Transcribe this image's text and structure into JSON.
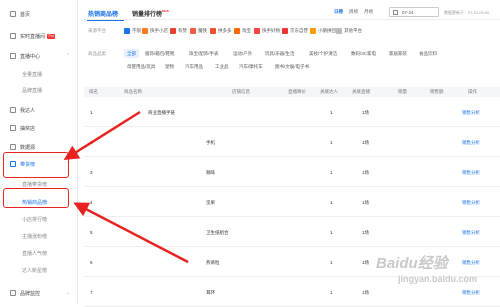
{
  "sidebar": {
    "items": [
      {
        "label": "首页",
        "icon": "home-icon"
      },
      {
        "label": "实时直播间",
        "icon": "live-icon",
        "badge": "Pro"
      },
      {
        "label": "直播中心",
        "icon": "broadcast-icon"
      },
      {
        "label": "全量直播",
        "icon": ""
      },
      {
        "label": "品牌直播",
        "icon": ""
      },
      {
        "label": "我达人",
        "icon": "user-icon"
      },
      {
        "label": "抽奖店",
        "icon": "store-icon"
      },
      {
        "label": "数据源",
        "icon": "data-icon"
      },
      {
        "label": "带货榜",
        "icon": "chart-icon"
      },
      {
        "label": "直播带货榜",
        "icon": ""
      },
      {
        "label": "热销商品榜",
        "icon": ""
      },
      {
        "label": "小店排行榜",
        "icon": ""
      },
      {
        "label": "主播涨粉榜",
        "icon": ""
      },
      {
        "label": "直播人气榜",
        "icon": ""
      },
      {
        "label": "达人新星榜",
        "icon": ""
      },
      {
        "label": "品牌监控",
        "icon": "brand-icon"
      }
    ]
  },
  "header": {
    "tabs": [
      "热销商品榜",
      "销量排行榜"
    ],
    "new_badge": "NEW",
    "ranges": [
      "日榜",
      "周榜",
      "月榜"
    ],
    "date": "07-24",
    "update_text": "数据更新于：07-21 00:00"
  },
  "filters": {
    "platform_label": "来源平台",
    "platforms": [
      {
        "label": "不限",
        "color": "#1a73e8"
      },
      {
        "label": "快手小店",
        "color": "#ff7a1a"
      },
      {
        "label": "有赞",
        "color": "#e83f2e"
      },
      {
        "label": "魔筷",
        "color": "#f25b3b"
      },
      {
        "label": "拼多多",
        "color": "#f24b2b"
      },
      {
        "label": "淘宝",
        "color": "#ff6a00"
      },
      {
        "label": "快手好物",
        "color": "#f44"
      },
      {
        "label": "京东自营",
        "color": "#e33"
      },
      {
        "label": "小鹅拼团",
        "color": "#f90"
      },
      {
        "label": "其他平台",
        "color": "#bbb"
      }
    ],
    "category_label": "商品品类",
    "categories_row1": [
      "全部",
      "服饰/箱包/鞋靴",
      "珠宝/配饰/手表",
      "运动/户外",
      "玩具/乐器/生活",
      "美妆/个护清洁",
      "数码/3C家电",
      "家居家装",
      "食品饮料"
    ],
    "categories_row2": [
      "母婴用品/玩具",
      "宠物",
      "汽车用品",
      "工业品",
      "汽车/摩托车",
      "图书/文娱/电子书"
    ]
  },
  "table": {
    "headers": [
      "排名",
      "商品名称",
      "店铺信息",
      "直播降价",
      "关联达人",
      "关联直播",
      "销量",
      "销售额",
      "操作"
    ],
    "rows": [
      {
        "rank": "1",
        "name": "商业直播手链",
        "anchors": "1",
        "lives": "1场",
        "action": "销售分析"
      },
      {
        "rank": "2",
        "name": "手机",
        "anchors": "1",
        "lives": "1场",
        "action": "销售分析"
      },
      {
        "rank": "3",
        "name": "咖啡",
        "anchors": "1",
        "lives": "1场",
        "action": "销售分析"
      },
      {
        "rank": "4",
        "name": "坚果",
        "anchors": "1",
        "lives": "1场",
        "action": "销售分析"
      },
      {
        "rank": "5",
        "name": "卫生纸组合",
        "anchors": "1",
        "lives": "1场",
        "action": "销售分析"
      },
      {
        "rank": "6",
        "name": "燕窝粒",
        "anchors": "1",
        "lives": "1场",
        "action": "销售分析"
      },
      {
        "rank": "7",
        "name": "耳环",
        "anchors": "1",
        "lives": "1场",
        "action": "销售分析"
      }
    ]
  },
  "watermark": {
    "main": "Baidu经验",
    "sub": "jingyan.baidu.com"
  },
  "colors": {
    "accent": "#1a73e8",
    "highlight": "#e8231f"
  }
}
